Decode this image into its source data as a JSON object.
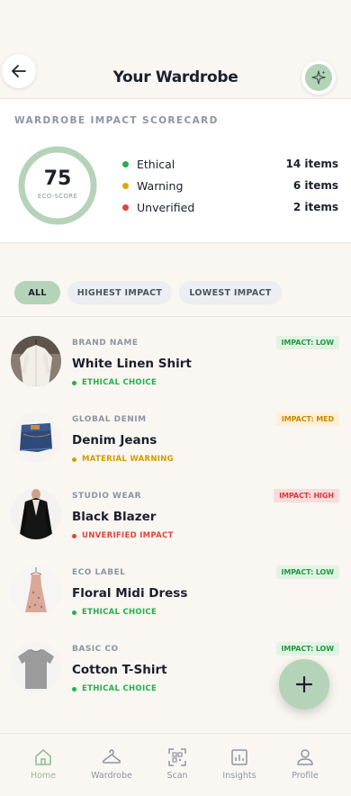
{
  "header": {
    "title": "Your Wardrobe"
  },
  "scorecard": {
    "title": "WARDROBE IMPACT SCORECARD",
    "score": "75",
    "score_fraction": 0.75,
    "score_label": "ECO-SCORE",
    "legend": [
      {
        "label": "Ethical",
        "count": "14 items",
        "color": "#22b14c"
      },
      {
        "label": "Warning",
        "count": "6 items",
        "color": "#e0a800"
      },
      {
        "label": "Unverified",
        "count": "2 items",
        "color": "#e0443a"
      }
    ]
  },
  "filters": [
    {
      "label": "ALL",
      "active": true
    },
    {
      "label": "HIGHEST IMPACT",
      "active": false
    },
    {
      "label": "LOWEST IMPACT",
      "active": false
    }
  ],
  "items": [
    {
      "brand": "BRAND NAME",
      "name": "White Linen Shirt",
      "status": "ETHICAL CHOICE",
      "status_color": "#22b14c",
      "impact": "IMPACT: LOW",
      "impact_bg": "#e2f3e4",
      "impact_color": "#1f9a3e"
    },
    {
      "brand": "GLOBAL DENIM",
      "name": "Denim Jeans",
      "status": "MATERIAL WARNING",
      "status_color": "#d49a00",
      "impact": "IMPACT: MED",
      "impact_bg": "#fbefd6",
      "impact_color": "#c88a00"
    },
    {
      "brand": "STUDIO WEAR",
      "name": "Black Blazer",
      "status": "UNVERIFIED IMPACT",
      "status_color": "#e0443a",
      "impact": "IMPACT: HIGH",
      "impact_bg": "#f7dcdc",
      "impact_color": "#d83a3a"
    },
    {
      "brand": "ECO LABEL",
      "name": "Floral Midi Dress",
      "status": "ETHICAL CHOICE",
      "status_color": "#22b14c",
      "impact": "IMPACT: LOW",
      "impact_bg": "#e2f3e4",
      "impact_color": "#1f9a3e"
    },
    {
      "brand": "BASIC CO",
      "name": "Cotton T-Shirt",
      "status": "ETHICAL CHOICE",
      "status_color": "#22b14c",
      "impact": "IMPACT: LOW",
      "impact_bg": "#e2f3e4",
      "impact_color": "#1f9a3e"
    }
  ],
  "tabs": [
    {
      "label": "Home",
      "icon": "home-icon",
      "active": true
    },
    {
      "label": "Wardrobe",
      "icon": "hanger-icon",
      "active": false
    },
    {
      "label": "Scan",
      "icon": "qr-scan-icon",
      "active": false
    },
    {
      "label": "Insights",
      "icon": "chart-icon",
      "active": false
    },
    {
      "label": "Profile",
      "icon": "user-icon",
      "active": false
    }
  ],
  "colors": {
    "accent": "#b5d3b8",
    "background": "#faf6f2"
  }
}
